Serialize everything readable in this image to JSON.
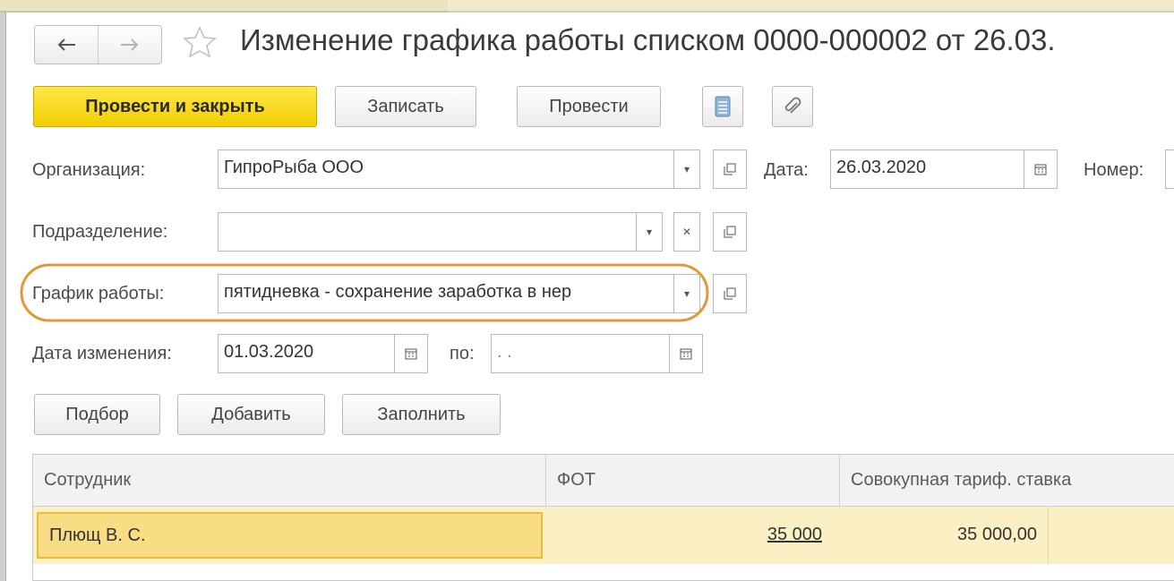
{
  "header": {
    "back_icon": "arrow-left-icon",
    "forward_icon": "arrow-right-icon",
    "star_icon": "star-icon",
    "title": "Изменение графика работы списком 0000-000002 от 26.03."
  },
  "toolbar": {
    "post_close_label": "Провести и закрыть",
    "save_label": "Записать",
    "post_label": "Провести",
    "report_icon": "document-list-icon",
    "attach_icon": "paperclip-icon"
  },
  "form": {
    "organization": {
      "label": "Организация:",
      "value": "ГипроРыба ООО"
    },
    "date": {
      "label": "Дата:",
      "value": "26.03.2020"
    },
    "number": {
      "label": "Номер:"
    },
    "department": {
      "label": "Подразделение:",
      "value": ""
    },
    "schedule": {
      "label": "График работы:",
      "value": "пятидневка - сохранение заработка в нер"
    },
    "change_date": {
      "label": "Дата изменения:",
      "value": "01.03.2020"
    },
    "to": {
      "label": "по:",
      "value": " .  . "
    }
  },
  "actions": {
    "pick_label": "Подбор",
    "add_label": "Добавить",
    "fill_label": "Заполнить"
  },
  "table": {
    "columns": [
      "Сотрудник",
      "ФОТ",
      "Совокупная тариф. ставка"
    ],
    "rows": [
      {
        "employee": "Плющ В. С.",
        "fot": "35 000",
        "rate": "35 000,00"
      }
    ]
  },
  "colors": {
    "primary_button": "#f3cd00",
    "highlight_oval": "#e8953a",
    "selected_row": "#fbf0c4"
  }
}
